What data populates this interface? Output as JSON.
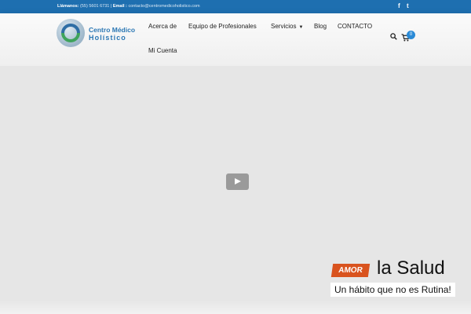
{
  "topbar": {
    "phone_label": "Llámanos:",
    "phone": "(55) 5601 6731",
    "separator": "|",
    "email_label": "Email :",
    "email": "contacto@centromedicoholistico.com",
    "social": [
      "f",
      "t"
    ],
    "color": "#1e6fb0"
  },
  "logo": {
    "line1": "Centro Médico",
    "line2": "Holístico"
  },
  "nav": {
    "items": [
      {
        "label": "Acerca de"
      },
      {
        "label": "Equipo de Profesionales"
      },
      {
        "label": "Servicios",
        "has_dropdown": true
      },
      {
        "label": "Blog"
      },
      {
        "label": "CONTACTO"
      },
      {
        "label": "Mi Cuenta"
      }
    ],
    "search_icon": "search-icon",
    "cart_icon": "shopping-cart-icon",
    "cart_count": "0"
  },
  "hero": {
    "play_icon": "play-icon",
    "badge": "AMOR",
    "headline": "la Salud",
    "subline": "Un hábito que no es Rutina!",
    "accent": "#d9531e"
  }
}
